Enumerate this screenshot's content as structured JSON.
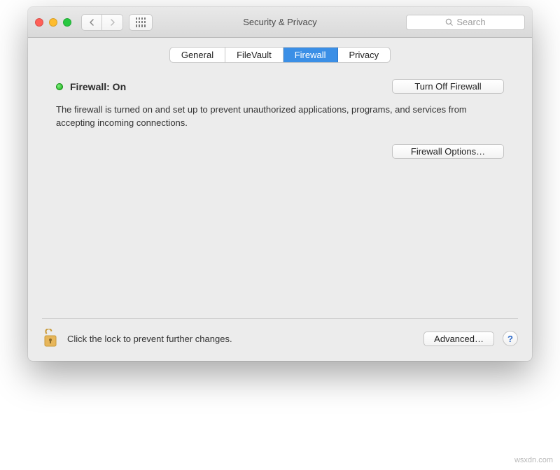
{
  "window": {
    "title": "Security & Privacy"
  },
  "search": {
    "placeholder": "Search"
  },
  "tabs": [
    {
      "id": "general",
      "label": "General",
      "active": false
    },
    {
      "id": "filevault",
      "label": "FileVault",
      "active": false
    },
    {
      "id": "firewall",
      "label": "Firewall",
      "active": true
    },
    {
      "id": "privacy",
      "label": "Privacy",
      "active": false
    }
  ],
  "firewall": {
    "status_label": "Firewall: On",
    "status_on": true,
    "toggle_button": "Turn Off Firewall",
    "description": "The firewall is turned on and set up to prevent unauthorized applications, programs, and services from accepting incoming connections.",
    "options_button": "Firewall Options…"
  },
  "footer": {
    "lock_text": "Click the lock to prevent further changes.",
    "advanced_button": "Advanced…",
    "help_label": "?"
  },
  "watermark": "wsxdn.com"
}
